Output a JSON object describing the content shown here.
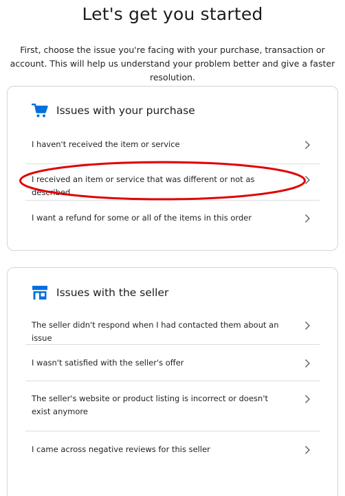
{
  "header": {
    "title": "Let's get you started",
    "intro": "First, choose the issue you're facing with your purchase, transaction or account. This will help us understand your problem better and give a faster resolution."
  },
  "colors": {
    "accent": "#0070e0",
    "annotation": "#e00000"
  },
  "purchase_section": {
    "icon": "cart-icon",
    "title": "Issues with your purchase",
    "items": [
      {
        "label": "I haven't received the item or service"
      },
      {
        "label": "I received an item or service that was different or not as described"
      },
      {
        "label": "I want a refund for some or all of the items in this order"
      }
    ]
  },
  "seller_section": {
    "icon": "storefront-icon",
    "title": "Issues with the seller",
    "items": [
      {
        "label": "The seller didn't respond when I had contacted them about an issue"
      },
      {
        "label": "I wasn't satisfied with the seller's offer"
      },
      {
        "label": "The seller's website or product listing is incorrect or doesn't exist anymore"
      },
      {
        "label": "I came across negative reviews for this seller"
      }
    ]
  }
}
